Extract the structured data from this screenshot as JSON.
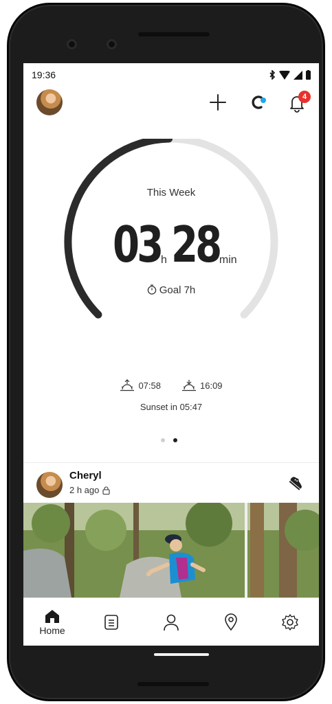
{
  "status_bar": {
    "time": "19:36",
    "icons": [
      "bluetooth-icon",
      "wifi-icon",
      "signal-icon",
      "battery-icon"
    ]
  },
  "header": {
    "icons": [
      "avatar",
      "add-icon",
      "watch-sync-icon",
      "notification-bell-icon"
    ],
    "notification_count": "4"
  },
  "weekly_summary": {
    "label": "This Week",
    "hours": "03",
    "hours_unit": "h",
    "minutes": "28",
    "minutes_unit": "min",
    "goal": "Goal 7h",
    "progress_fraction": 0.4952
  },
  "sun": {
    "sunrise": "07:58",
    "sunset": "16:09",
    "sunset_in": "Sunset in 05:47"
  },
  "pager": {
    "count": 2,
    "active": 2
  },
  "feed": {
    "name": "Cheryl",
    "time": "2 h ago",
    "activity_icon": "trail-running-shoe-icon"
  },
  "bottom_nav": [
    {
      "label": "Home",
      "icon": "home-icon",
      "active": true
    },
    {
      "label": "",
      "icon": "diary-icon"
    },
    {
      "label": "",
      "icon": "profile-icon"
    },
    {
      "label": "",
      "icon": "map-pin-icon"
    },
    {
      "label": "",
      "icon": "settings-icon"
    }
  ],
  "colors": {
    "ring_progress": "#2b2b2b",
    "ring_track": "#e3e3e3",
    "badge": "#e8312c",
    "sync_dot": "#1ea7ea"
  }
}
